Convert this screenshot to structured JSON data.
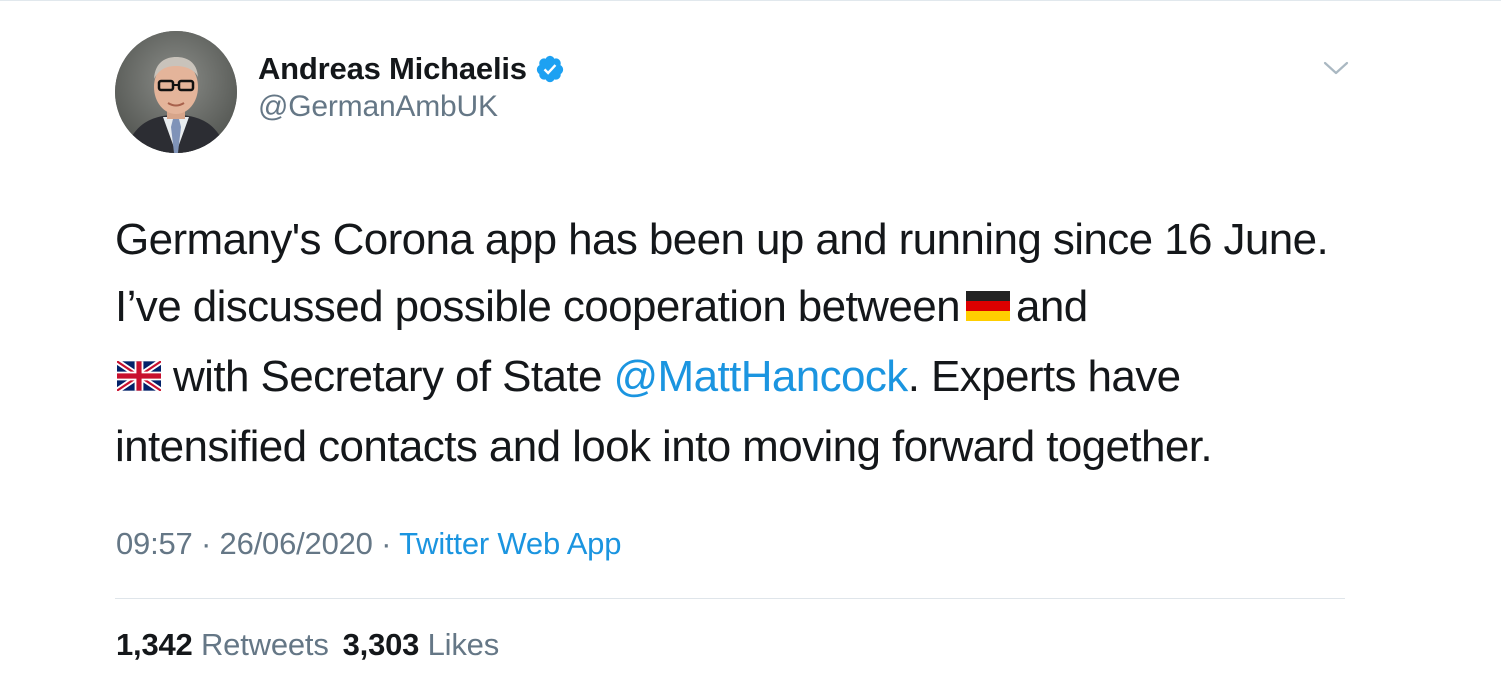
{
  "tweet": {
    "author": {
      "display_name": "Andreas Michaelis",
      "handle": "@GermanAmbUK",
      "verified": true,
      "avatar_icon": "profile-photo"
    },
    "text": {
      "part1": "Germany's Corona app has been up and running since 16 June. I’ve discussed possible cooperation between",
      "flag1": "germany-flag",
      "part2": "and",
      "flag2": "united-kingdom-flag",
      "part3": "with Secretary of State",
      "mention": "@MattHancock",
      "part4": ". Experts have intensified contacts and look into moving forward together."
    },
    "meta": {
      "time": "09:57",
      "separator": "·",
      "date": "26/06/2020",
      "source": "Twitter Web App"
    },
    "stats": {
      "retweets_count": "1,342",
      "retweets_label": "Retweets",
      "likes_count": "3,303",
      "likes_label": "Likes"
    },
    "colors": {
      "link": "#1b95e0",
      "muted": "#657786",
      "text": "#14171a",
      "verified": "#1da1f2"
    }
  }
}
